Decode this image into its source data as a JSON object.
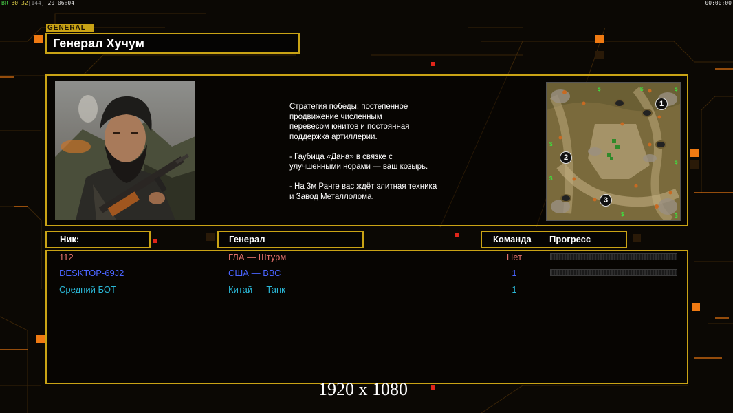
{
  "hud": {
    "left_tag": "BR",
    "left_num_a": "30",
    "left_num_b": "32",
    "left_bracket": "[144]",
    "left_time": "20:06:04",
    "right_time": "00:00:00"
  },
  "colors": {
    "gold_border": "#c9a315",
    "orange_accent": "#f07a12",
    "red_accent": "#e0251a",
    "player_gla": "#e0706a",
    "player_usa": "#4a64ff",
    "player_china": "#2ab7d6"
  },
  "general_badge": "GENERAL",
  "general_name": "Генерал Хучум",
  "portrait_icon": "general-portrait",
  "strategy_lines": [
    "Стратегия победы: постепенное",
    "продвижение численным",
    "перевесом юнитов и постоянная",
    "поддержка артиллерии.",
    "",
    "- Гаубица «Дана» в связке с",
    "улучшенными норами — ваш козырь.",
    "",
    "- На 3м Ранге вас ждёт элитная техника",
    "и Завод Металлолома."
  ],
  "minimap": {
    "start_positions": [
      "1",
      "2",
      "3"
    ]
  },
  "table": {
    "headers": {
      "nick": "Ник:",
      "general": "Генерал",
      "team": "Команда",
      "progress": "Прогресс"
    },
    "rows": [
      {
        "nick": "112",
        "general": "ГЛА — Штурм",
        "team": "Нет",
        "has_progress": true,
        "color_key": "player_gla"
      },
      {
        "nick": "DESKTOP-69J2",
        "general": "США — ВВС",
        "team": "1",
        "has_progress": true,
        "color_key": "player_usa"
      },
      {
        "nick": "Средний БОТ",
        "general": "Китай — Танк",
        "team": "1",
        "has_progress": false,
        "color_key": "player_china"
      }
    ]
  },
  "resolution_label": "1920 x 1080"
}
